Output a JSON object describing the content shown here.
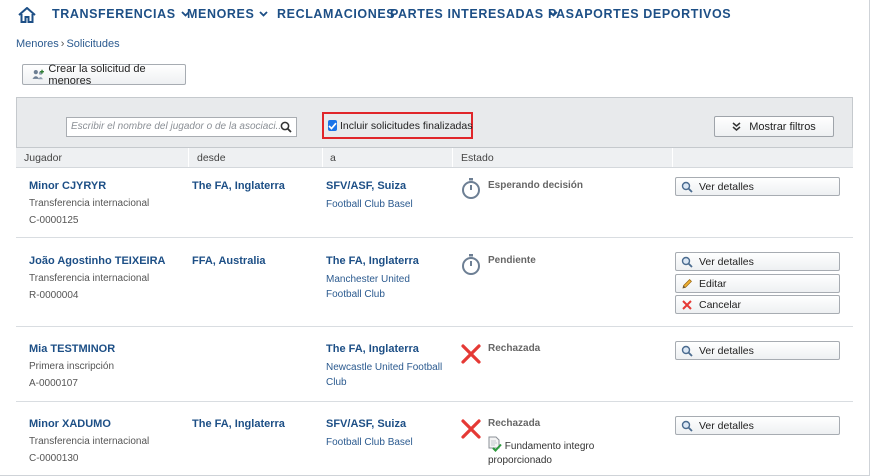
{
  "nav": {
    "items": [
      {
        "label": "TRANSFERENCIAS",
        "has_dropdown": true
      },
      {
        "label": "MENORES",
        "has_dropdown": true
      },
      {
        "label": "RECLAMACIONES",
        "has_dropdown": false
      },
      {
        "label": "PARTES INTERESADAS",
        "has_dropdown": true
      },
      {
        "label": "PASAPORTES DEPORTIVOS",
        "has_dropdown": false
      }
    ]
  },
  "breadcrumb": {
    "parent": "Menores",
    "current": "Solicitudes"
  },
  "toolbar": {
    "create_label": "Crear la solicitud de menores"
  },
  "filters": {
    "search_placeholder": "Escribir el nombre del jugador o de la asociaci...",
    "include_finished_label": "Incluir solicitudes finalizadas",
    "include_finished_checked": true,
    "show_filters_label": "Mostrar filtros"
  },
  "table": {
    "columns": [
      "Jugador",
      "desde",
      "a",
      "Estado"
    ],
    "rows": [
      {
        "player": "Minor CJYRYR",
        "type": "Transferencia internacional",
        "code": "C-0000125",
        "from_assoc": "The FA, Inglaterra",
        "from_club": "",
        "to_assoc": "SFV/ASF, Suiza",
        "to_club": "Football Club Basel",
        "status": "Esperando decisión",
        "status_icon": "stopwatch-icon",
        "note": "",
        "actions": [
          {
            "label": "Ver detalles",
            "icon": "search-icon"
          }
        ]
      },
      {
        "player": "João Agostinho TEIXEIRA",
        "type": "Transferencia internacional",
        "code": "R-0000004",
        "from_assoc": "FFA, Australia",
        "from_club": "",
        "to_assoc": "The FA, Inglaterra",
        "to_club": "Manchester United Football Club",
        "status": "Pendiente",
        "status_icon": "stopwatch-icon",
        "note": "",
        "actions": [
          {
            "label": "Ver detalles",
            "icon": "search-icon"
          },
          {
            "label": "Editar",
            "icon": "pencil-icon"
          },
          {
            "label": "Cancelar",
            "icon": "cross-icon"
          }
        ]
      },
      {
        "player": "Mia TESTMINOR",
        "type": "Primera inscripción",
        "code": "A-0000107",
        "from_assoc": "",
        "from_club": "",
        "to_assoc": "The FA, Inglaterra",
        "to_club": "Newcastle United Football Club",
        "status": "Rechazada",
        "status_icon": "red-cross-icon",
        "note": "",
        "actions": [
          {
            "label": "Ver detalles",
            "icon": "search-icon"
          }
        ]
      },
      {
        "player": "Minor XADUMO",
        "type": "Transferencia internacional",
        "code": "C-0000130",
        "from_assoc": "The FA, Inglaterra",
        "from_club": "",
        "to_assoc": "SFV/ASF, Suiza",
        "to_club": "Football Club Basel",
        "status": "Rechazada",
        "status_icon": "red-cross-icon",
        "note": "Fundamento integro proporcionado",
        "actions": [
          {
            "label": "Ver detalles",
            "icon": "search-icon"
          }
        ]
      }
    ]
  },
  "colors": {
    "link_blue": "#1d4f86",
    "highlight_red": "#e0262a",
    "checkbox_blue": "#1a73e8",
    "reject_red": "#e53935"
  }
}
